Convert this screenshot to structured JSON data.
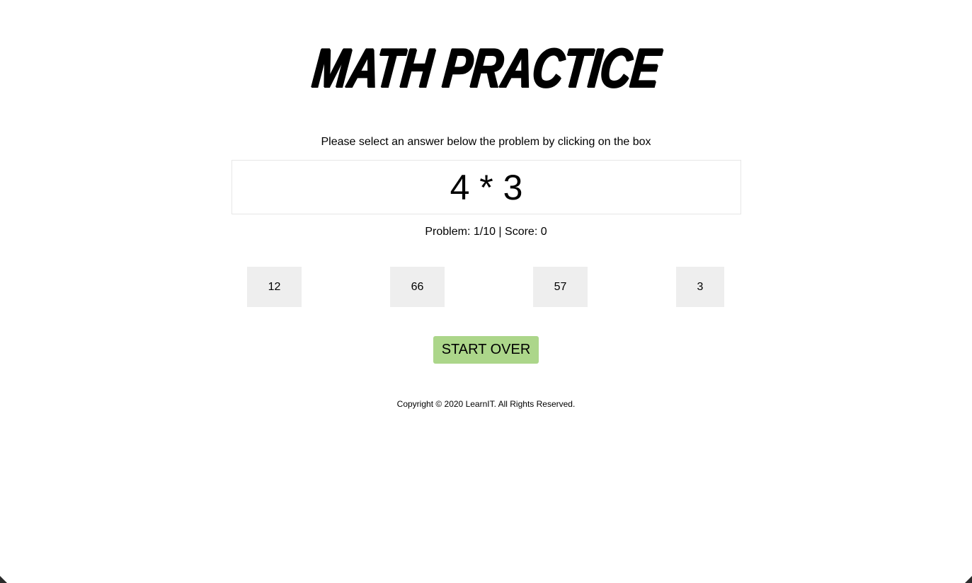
{
  "header": {
    "title": "MATH PRACTICE"
  },
  "main": {
    "instructions": "Please select an answer below the problem by clicking on the box",
    "problem": "4 * 3",
    "status": "Problem: 1/10 | Score: 0",
    "answers": [
      "12",
      "66",
      "57",
      "3"
    ],
    "start_over_label": "START OVER"
  },
  "footer": {
    "copyright": "Copyright © 2020 LearnIT. All Rights Reserved."
  },
  "colors": {
    "answer_bg": "#eeeeee",
    "start_over_bg": "#acd68a",
    "problem_border": "#e6e6e6"
  }
}
